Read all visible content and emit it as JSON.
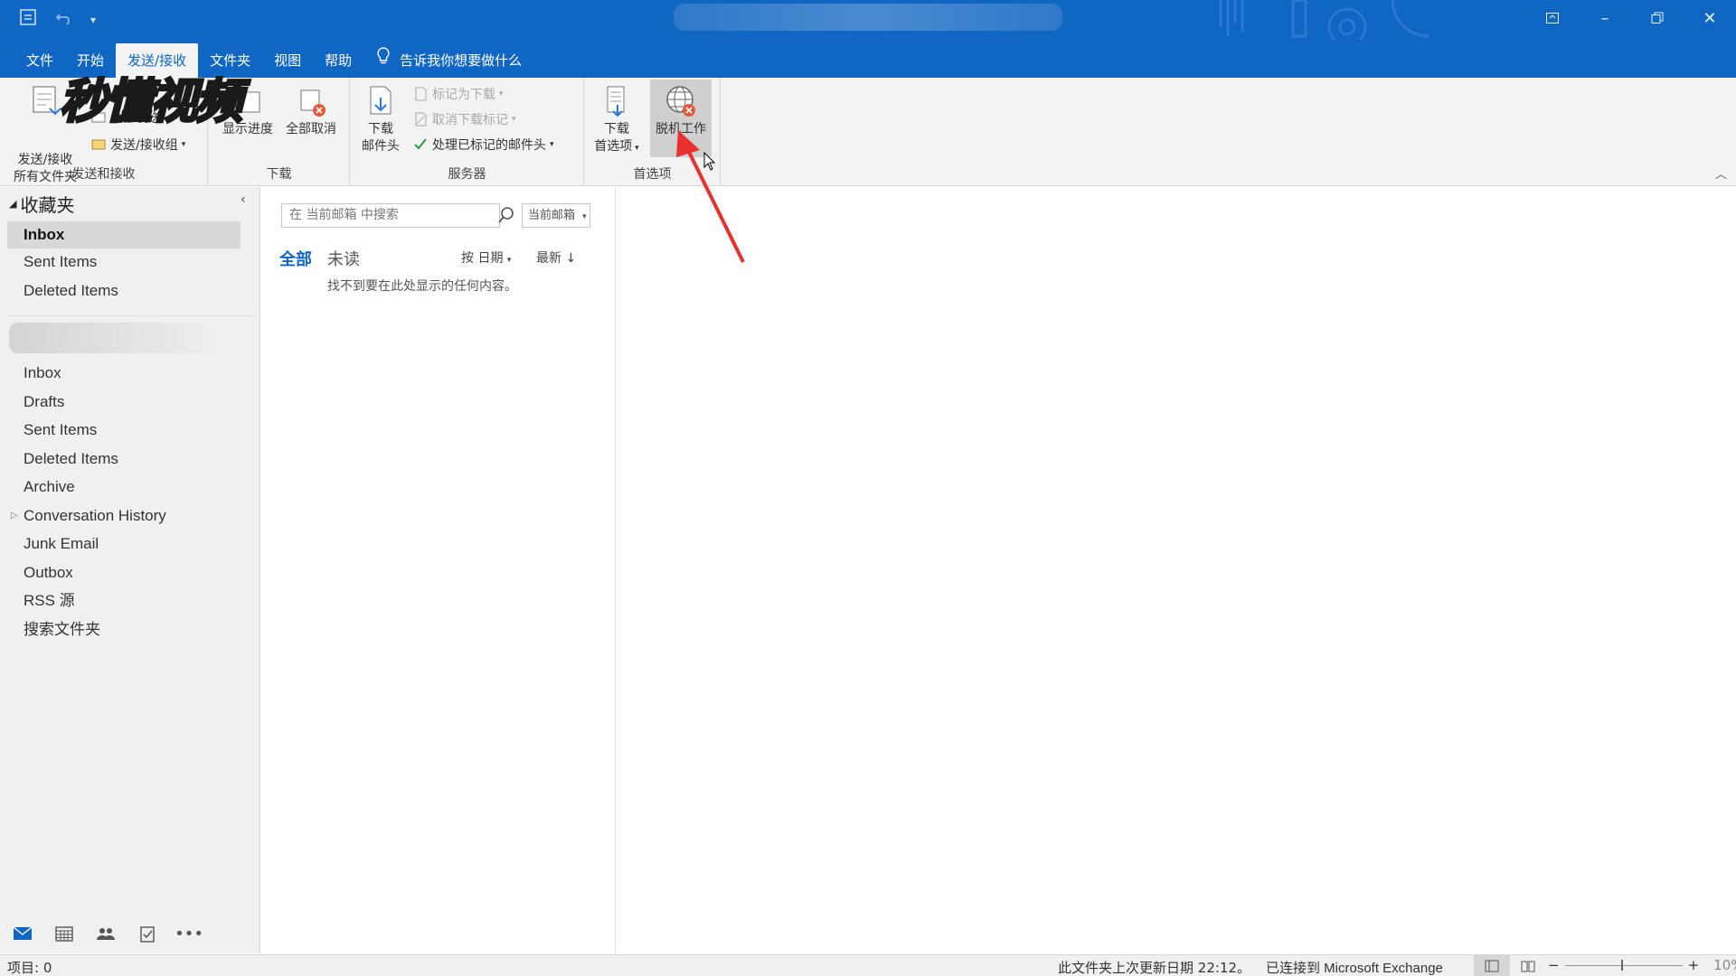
{
  "titlebar": {
    "quick_access": [
      "send-receive-icon",
      "undo-icon",
      "customize-icon"
    ],
    "window_controls": [
      "ribbon-display-icon",
      "minimize-icon",
      "restore-icon",
      "close-icon"
    ]
  },
  "menu": {
    "tabs": [
      "文件",
      "开始",
      "发送/接收",
      "文件夹",
      "视图",
      "帮助"
    ],
    "active_tab": "发送/接收",
    "tell_me": "告诉我你想要做什么"
  },
  "ribbon": {
    "watermark": "秒懂视频",
    "groups": {
      "send_receive": {
        "label": "发送和接收",
        "send_receive_all_line1": "发送/接收",
        "send_receive_all_line2": "所有文件夹",
        "send_all": "全部发送",
        "send_receive_groups": "发送/接收组"
      },
      "download": {
        "label": "下载",
        "show_progress": "显示进度",
        "cancel_all": "全部取消"
      },
      "server": {
        "label": "服务器",
        "download_headers_line1": "下载",
        "download_headers_line2": "邮件头",
        "mark_to_download": "标记为下载",
        "unmark_to_download": "取消下载标记",
        "process_marked_headers": "处理已标记的邮件头"
      },
      "preferences": {
        "label": "首选项",
        "download_prefs_line1": "下载",
        "download_prefs_line2": "首选项",
        "work_offline": "脱机工作"
      }
    }
  },
  "folders": {
    "favorites_header": "收藏夹",
    "favorites": [
      "Inbox",
      "Sent Items",
      "Deleted Items"
    ],
    "selected": "Inbox",
    "account_folders": [
      "Inbox",
      "Drafts",
      "Sent Items",
      "Deleted Items",
      "Archive",
      "Conversation History",
      "Junk Email",
      "Outbox",
      "RSS 源",
      "搜索文件夹"
    ]
  },
  "navbar": [
    "mail-icon",
    "calendar-icon",
    "people-icon",
    "tasks-icon",
    "more-icon"
  ],
  "message_list": {
    "search_placeholder": "在 当前邮箱 中搜索",
    "scope": "当前邮箱",
    "filter_all": "全部",
    "filter_unread": "未读",
    "sort_by": "按 日期",
    "sort_order": "最新 ↓",
    "empty_text": "找不到要在此处显示的任何内容。"
  },
  "statusbar": {
    "items": "项目: 0",
    "updated": "此文件夹上次更新日期 22:12。",
    "connection": "已连接到 Microsoft Exchange",
    "zoom": "10%"
  },
  "colors": {
    "accent": "#0f66c3",
    "annotation": "#e8302f"
  }
}
